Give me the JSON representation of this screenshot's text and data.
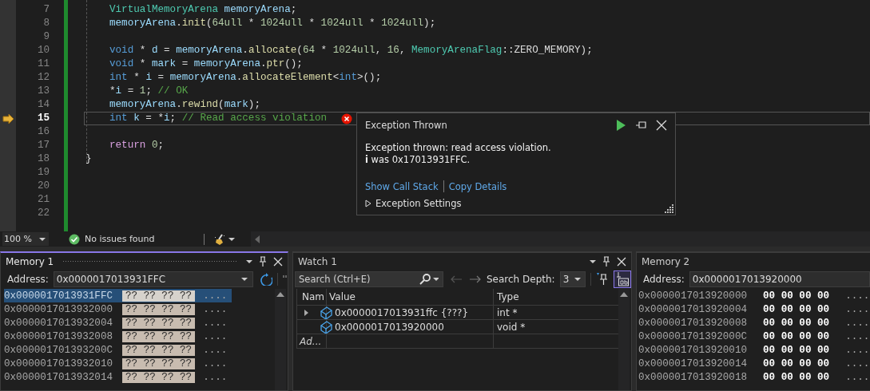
{
  "editor": {
    "lines": [
      {
        "number": "7",
        "indented": true,
        "current": false,
        "error": false,
        "tokens": [
          {
            "kind": "type",
            "text": "VirtualMemoryArena "
          },
          {
            "kind": "var",
            "text": "memoryArena"
          },
          {
            "kind": "plain",
            "text": ";"
          }
        ]
      },
      {
        "number": "8",
        "indented": true,
        "current": false,
        "error": false,
        "tokens": [
          {
            "kind": "var",
            "text": "memoryArena"
          },
          {
            "kind": "plain",
            "text": "."
          },
          {
            "kind": "func",
            "text": "init"
          },
          {
            "kind": "plain",
            "text": "("
          },
          {
            "kind": "num",
            "text": "64ull"
          },
          {
            "kind": "plain",
            "text": " * "
          },
          {
            "kind": "num",
            "text": "1024ull"
          },
          {
            "kind": "plain",
            "text": " * "
          },
          {
            "kind": "num",
            "text": "1024ull"
          },
          {
            "kind": "plain",
            "text": " * "
          },
          {
            "kind": "num",
            "text": "1024ull"
          },
          {
            "kind": "plain",
            "text": ");"
          }
        ]
      },
      {
        "number": "9",
        "current": false,
        "error": false
      },
      {
        "number": "10",
        "indented": true,
        "current": false,
        "error": false,
        "tokens": [
          {
            "kind": "keyword",
            "text": "void"
          },
          {
            "kind": "plain",
            "text": " * "
          },
          {
            "kind": "var",
            "text": "d"
          },
          {
            "kind": "plain",
            "text": " = "
          },
          {
            "kind": "var",
            "text": "memoryArena"
          },
          {
            "kind": "plain",
            "text": "."
          },
          {
            "kind": "func",
            "text": "allocate"
          },
          {
            "kind": "plain",
            "text": "("
          },
          {
            "kind": "num",
            "text": "64"
          },
          {
            "kind": "plain",
            "text": " * "
          },
          {
            "kind": "num",
            "text": "1024ull"
          },
          {
            "kind": "plain",
            "text": ", "
          },
          {
            "kind": "num",
            "text": "16"
          },
          {
            "kind": "plain",
            "text": ", "
          },
          {
            "kind": "type",
            "text": "MemoryArenaFlag"
          },
          {
            "kind": "plain",
            "text": "::ZERO_MEMORY);"
          }
        ]
      },
      {
        "number": "11",
        "indented": true,
        "current": false,
        "error": false,
        "tokens": [
          {
            "kind": "keyword",
            "text": "void"
          },
          {
            "kind": "plain",
            "text": " * "
          },
          {
            "kind": "var",
            "text": "mark"
          },
          {
            "kind": "plain",
            "text": " = "
          },
          {
            "kind": "var",
            "text": "memoryArena"
          },
          {
            "kind": "plain",
            "text": "."
          },
          {
            "kind": "func",
            "text": "ptr"
          },
          {
            "kind": "plain",
            "text": "();"
          }
        ]
      },
      {
        "number": "12",
        "indented": true,
        "current": false,
        "error": false,
        "tokens": [
          {
            "kind": "keyword",
            "text": "int"
          },
          {
            "kind": "plain",
            "text": " * "
          },
          {
            "kind": "var",
            "text": "i"
          },
          {
            "kind": "plain",
            "text": " = "
          },
          {
            "kind": "var",
            "text": "memoryArena"
          },
          {
            "kind": "plain",
            "text": "."
          },
          {
            "kind": "func",
            "text": "allocateElement"
          },
          {
            "kind": "plain",
            "text": "<"
          },
          {
            "kind": "keyword",
            "text": "int"
          },
          {
            "kind": "plain",
            "text": ">();"
          }
        ]
      },
      {
        "number": "13",
        "indented": true,
        "current": false,
        "error": false,
        "tokens": [
          {
            "kind": "plain",
            "text": "*"
          },
          {
            "kind": "var",
            "text": "i"
          },
          {
            "kind": "plain",
            "text": " = "
          },
          {
            "kind": "num",
            "text": "1"
          },
          {
            "kind": "plain",
            "text": "; "
          },
          {
            "kind": "comment",
            "text": "// OK"
          }
        ]
      },
      {
        "number": "14",
        "indented": true,
        "current": false,
        "error": false,
        "tokens": [
          {
            "kind": "var",
            "text": "memoryArena"
          },
          {
            "kind": "plain",
            "text": "."
          },
          {
            "kind": "func",
            "text": "rewind"
          },
          {
            "kind": "plain",
            "text": "("
          },
          {
            "kind": "var",
            "text": "mark"
          },
          {
            "kind": "plain",
            "text": ");"
          }
        ]
      },
      {
        "number": "15",
        "indented": true,
        "current": true,
        "error": true,
        "tokens": [
          {
            "kind": "keyword",
            "text": "int "
          },
          {
            "kind": "var",
            "text": "k"
          },
          {
            "kind": "plain",
            "text": " = *"
          },
          {
            "kind": "var",
            "text": "i"
          },
          {
            "kind": "plain",
            "text": "; "
          },
          {
            "kind": "comment",
            "text": "// Read access violation"
          }
        ]
      },
      {
        "number": "16",
        "current": false,
        "error": false
      },
      {
        "number": "17",
        "indented": true,
        "current": false,
        "error": false,
        "tokens": [
          {
            "kind": "control",
            "text": "return "
          },
          {
            "kind": "num",
            "text": "0"
          },
          {
            "kind": "plain",
            "text": ";"
          }
        ]
      },
      {
        "number": "18",
        "indented": false,
        "current": false,
        "error": false,
        "tokens": [
          {
            "kind": "plain",
            "text": "}"
          }
        ]
      },
      {
        "number": "19",
        "current": false,
        "error": false
      },
      {
        "number": "20",
        "current": false,
        "error": false
      },
      {
        "number": "21",
        "current": false,
        "error": false
      },
      {
        "number": "22",
        "current": false,
        "error": false
      }
    ]
  },
  "exception_popup": {
    "title": "Exception Thrown",
    "message": [
      "Exception thrown: read access violation.",
      "**i** was 0x17013931FFC."
    ],
    "links": [
      "Show Call Stack",
      "Copy Details"
    ],
    "section": {
      "label": "Exception Settings",
      "expanded": false
    }
  },
  "status_bar": {
    "zoom": "100 %",
    "issues": "No issues found"
  },
  "memory_1": {
    "title": "Memory 1",
    "focused": true,
    "address_label": "Address:",
    "address": "0x0000017013931FFC",
    "rows": [
      {
        "address": "0x0000017013931FFC",
        "bytes": "?? ?? ?? ??",
        "chars": "....",
        "readable": false,
        "selected": true
      },
      {
        "address": "0x0000017013932000",
        "bytes": "?? ?? ?? ??",
        "chars": "....",
        "readable": false,
        "selected": false
      },
      {
        "address": "0x0000017013932004",
        "bytes": "?? ?? ?? ??",
        "chars": "....",
        "readable": false,
        "selected": false
      },
      {
        "address": "0x0000017013932008",
        "bytes": "?? ?? ?? ??",
        "chars": "....",
        "readable": false,
        "selected": false
      },
      {
        "address": "0x000001701393200C",
        "bytes": "?? ?? ?? ??",
        "chars": "....",
        "readable": false,
        "selected": false
      },
      {
        "address": "0x0000017013932010",
        "bytes": "?? ?? ?? ??",
        "chars": "....",
        "readable": false,
        "selected": false
      },
      {
        "address": "0x0000017013932014",
        "bytes": "?? ?? ?? ??",
        "chars": "....",
        "readable": false,
        "selected": false
      }
    ]
  },
  "watch_1": {
    "title": "Watch 1",
    "search": {
      "placeholder": "Search (Ctrl+E)"
    },
    "search_depth_label": "Search Depth:",
    "search_depth": "3",
    "columns": [
      "Nam",
      "Value",
      "Type"
    ],
    "rows": [
      {
        "value": "0x0000017013931ffc {???}",
        "type": "int *",
        "expandable": true
      },
      {
        "value": "0x0000017013920000",
        "type": "void *",
        "expandable": false
      }
    ],
    "add_item": "Ad..."
  },
  "memory_2": {
    "title": "Memory 2",
    "focused": false,
    "address_label": "Address:",
    "address": "0x0000017013920000",
    "rows": [
      {
        "address": "0x0000017013920000",
        "bytes": "00 00 00 00",
        "chars": "....",
        "readable": true,
        "selected": false
      },
      {
        "address": "0x0000017013920004",
        "bytes": "00 00 00 00",
        "chars": "....",
        "readable": true,
        "selected": false
      },
      {
        "address": "0x0000017013920008",
        "bytes": "00 00 00 00",
        "chars": "....",
        "readable": true,
        "selected": false
      },
      {
        "address": "0x000001701392000C",
        "bytes": "00 00 00 00",
        "chars": "....",
        "readable": true,
        "selected": false
      },
      {
        "address": "0x0000017013920010",
        "bytes": "00 00 00 00",
        "chars": "....",
        "readable": true,
        "selected": false
      },
      {
        "address": "0x0000017013920014",
        "bytes": "00 00 00 00",
        "chars": "....",
        "readable": true,
        "selected": false
      },
      {
        "address": "0x0000017013920018",
        "bytes": "00 00 00 00",
        "chars": "....",
        "readable": true,
        "selected": false
      }
    ]
  }
}
